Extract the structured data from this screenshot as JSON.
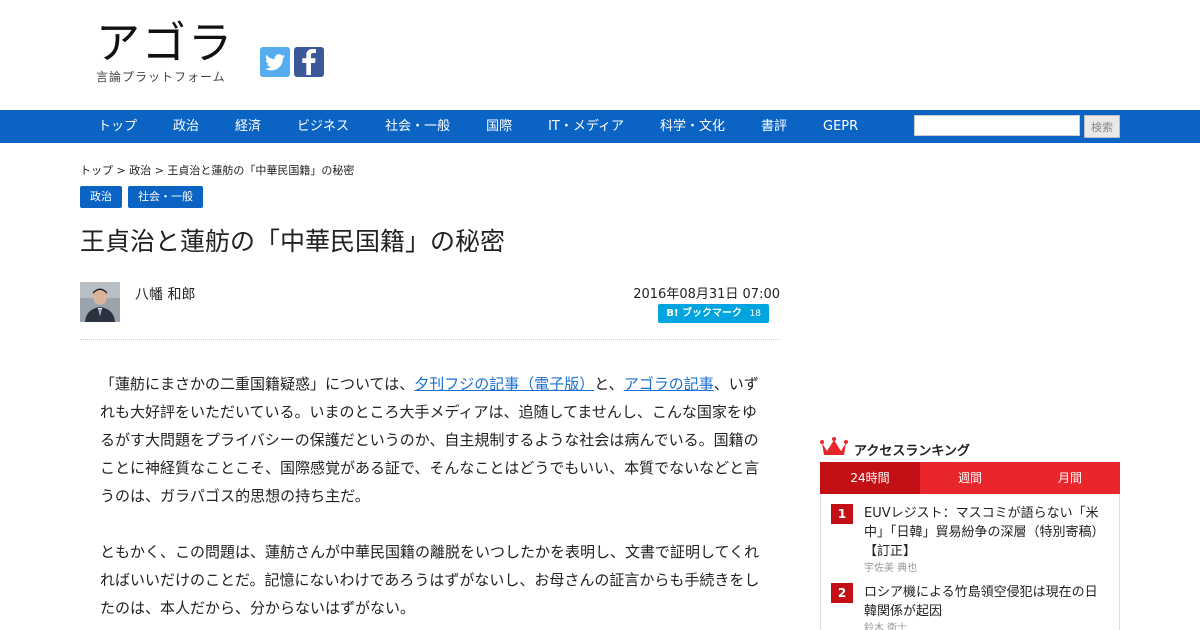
{
  "header": {
    "logo_text": "アゴラ",
    "logo_subtitle": "言論プラットフォーム",
    "social": [
      {
        "name": "twitter-icon",
        "color": "#55acee"
      },
      {
        "name": "facebook-icon",
        "color": "#3b5998"
      }
    ]
  },
  "nav": {
    "items": [
      "トップ",
      "政治",
      "経済",
      "ビジネス",
      "社会・一般",
      "国際",
      "IT・メディア",
      "科学・文化",
      "書評",
      "GEPR"
    ],
    "search_placeholder": "",
    "search_button": "検索",
    "color": "#0b64c4"
  },
  "breadcrumb": "トップ > 政治 > 王貞治と蓮舫の「中華民国籍」の秘密",
  "tags": [
    "政治",
    "社会・一般"
  ],
  "article": {
    "title": "王貞治と蓮舫の「中華民国籍」の秘密",
    "author": "八幡 和郎",
    "date": "2016年08月31日 07:00",
    "hatena_label": "ブックマーク",
    "hatena_count": "18",
    "p1_a": "「蓮舫にまさかの二重国籍疑惑」については、",
    "p1_link1": "夕刊フジの記事（電子版）",
    "p1_b": "と、",
    "p1_link2": "アゴラの記事",
    "p1_c": "、いずれも大好評をいただいている。いまのところ大手メディアは、追随してませんし、こんな国家をゆるがす大問題をプライバシーの保護だというのか、自主規制するような社会は病んでいる。国籍のことに神経質なことこそ、国際感覚がある証で、そんなことはどうでもいい、本質でないなどと言うのは、ガラパゴス的思想の持ち主だ。",
    "p2": "ともかく、この問題は、蓮舫さんが中華民国籍の離脱をいつしたかを表明し、文書で証明してくれればいいだけのことだ。記憶にないわけであろうはずがないし、お母さんの証言からも手続きをしたのは、本人だから、分からないはずがない。"
  },
  "ranking": {
    "title": "アクセスランキング",
    "tabs": [
      "24時間",
      "週間",
      "月間"
    ],
    "items": [
      {
        "num": "1",
        "text": "EUVレジスト：マスコミが語らない「米中」「日韓」貿易紛争の深層（特別寄稿）【訂正】",
        "author": "宇佐美 典也"
      },
      {
        "num": "2",
        "text": "ロシア機による竹島領空侵犯は現在の日韓関係が起因",
        "author": "鈴木 衛士"
      }
    ],
    "accent": "#c21016"
  }
}
